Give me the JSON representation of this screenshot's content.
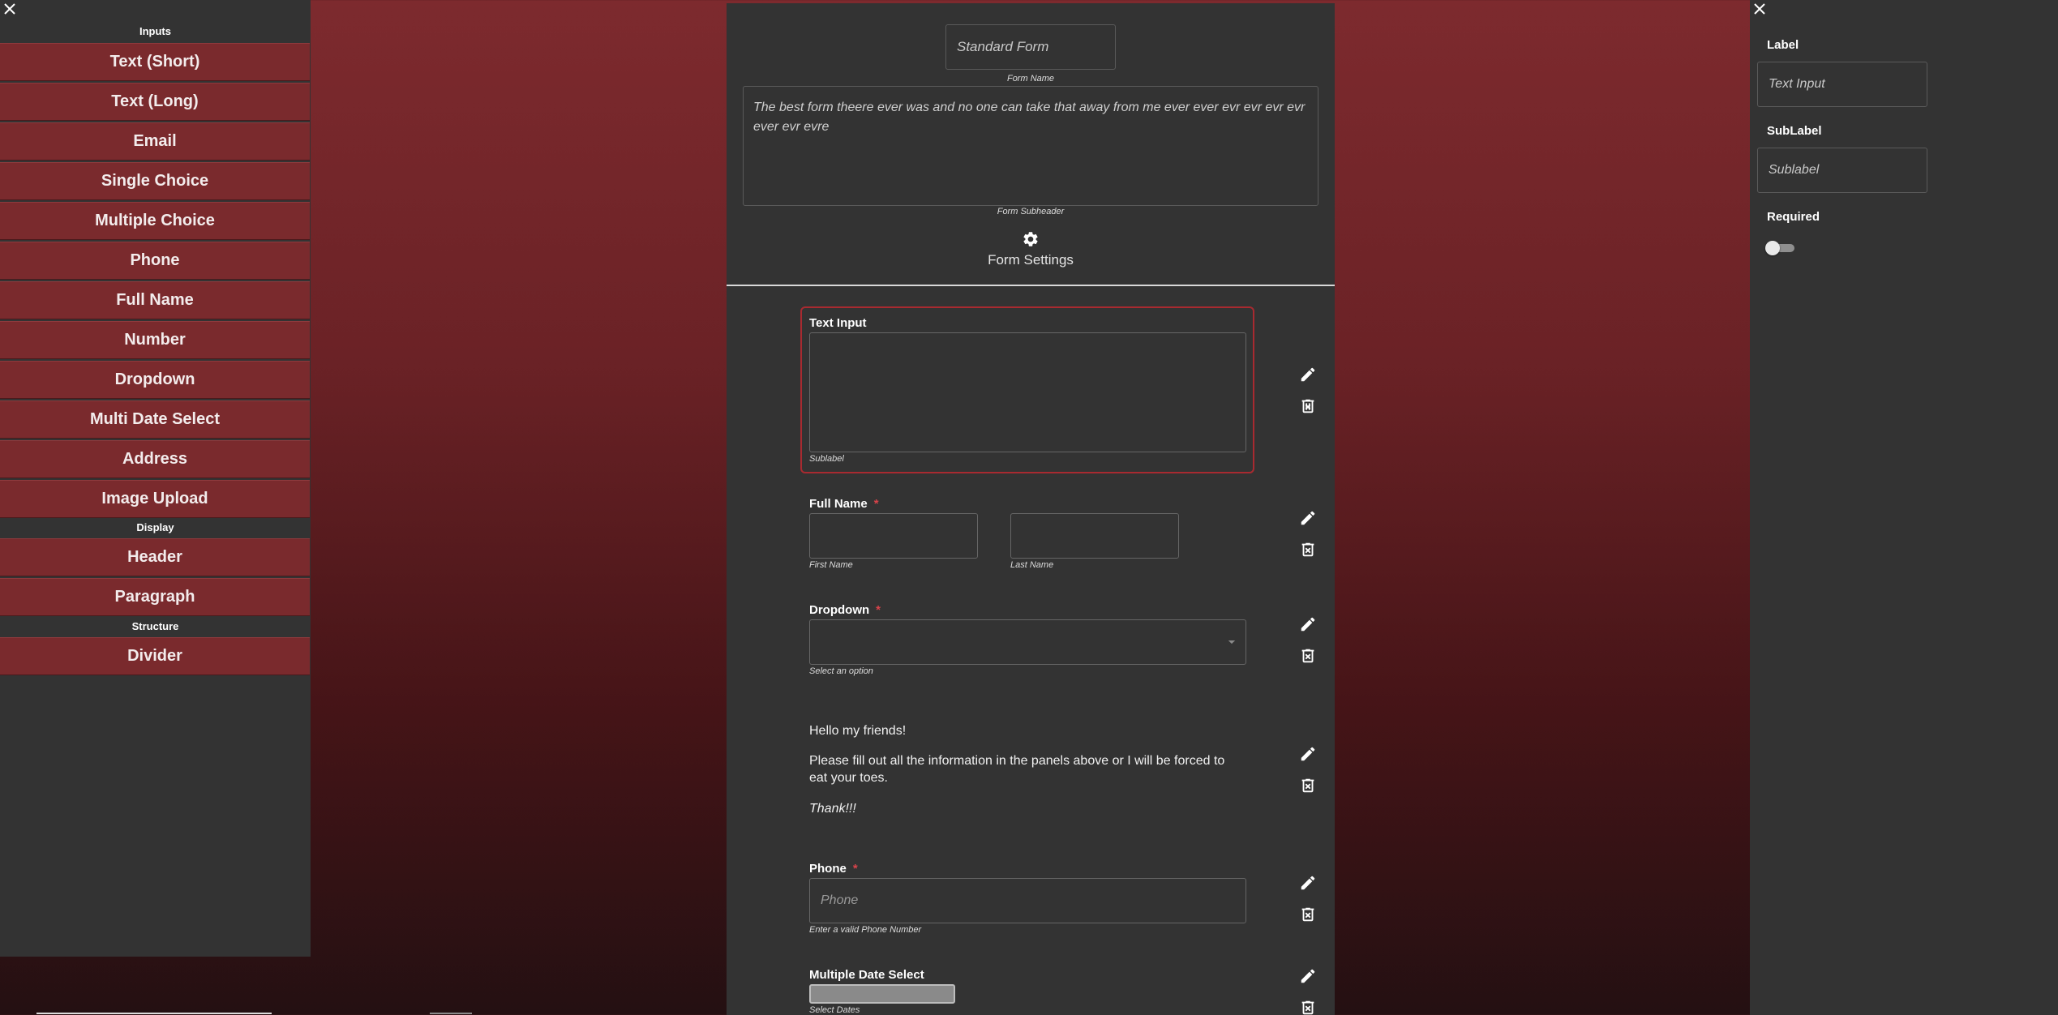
{
  "left_panel": {
    "sections": {
      "inputs": "Inputs",
      "display": "Display",
      "structure": "Structure"
    },
    "inputs": [
      "Text (Short)",
      "Text (Long)",
      "Email",
      "Single Choice",
      "Multiple Choice",
      "Phone",
      "Full Name",
      "Number",
      "Dropdown",
      "Multi Date Select",
      "Address",
      "Image Upload"
    ],
    "display": [
      "Header",
      "Paragraph"
    ],
    "structure": [
      "Divider"
    ]
  },
  "form": {
    "name_value": "Standard Form",
    "name_caption": "Form Name",
    "subheader_value": "The best form theere ever was  and no one can take that away from me ever ever evr evr evr evr ever evr evre",
    "subheader_caption": "Form Subheader",
    "settings_label": "Form Settings",
    "fields": {
      "text_input": {
        "label": "Text Input",
        "sublabel": "Sublabel"
      },
      "full_name": {
        "label": "Full Name",
        "required": "*",
        "first_caption": "First Name",
        "last_caption": "Last Name"
      },
      "dropdown": {
        "label": "Dropdown",
        "required": "*",
        "caption": "Select an option"
      },
      "paragraph": {
        "line1": "Hello my friends!",
        "line2": "Please fill out all the information in the panels above or I will be forced to eat your toes.",
        "line3": "Thank!!!"
      },
      "phone": {
        "label": "Phone",
        "required": "*",
        "placeholder": "Phone",
        "caption": "Enter a valid Phone Number"
      },
      "multi_date": {
        "label": "Multiple Date Select",
        "caption": "Select Dates"
      }
    }
  },
  "right_panel": {
    "label_title": "Label",
    "label_value": "Text Input",
    "sublabel_title": "SubLabel",
    "sublabel_value": "Sublabel",
    "required_title": "Required",
    "required_on": false
  },
  "icons": [
    "close-icon",
    "gear-icon",
    "pencil-icon",
    "trash-icon",
    "chevron-down-icon"
  ],
  "colors": {
    "accent": "#7a2a2d",
    "panel": "#333333",
    "required": "#d9434a",
    "selected_outline": "#a82a30"
  }
}
